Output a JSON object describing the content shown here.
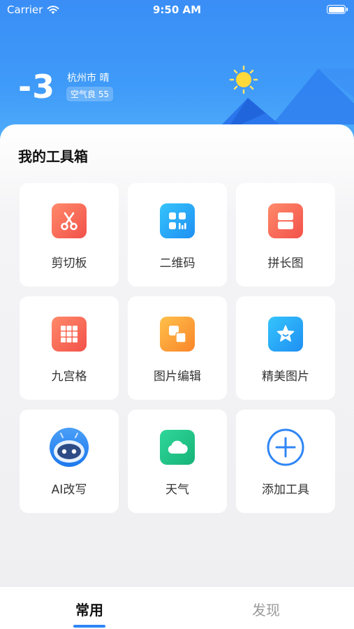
{
  "status_bar": {
    "carrier": "Carrier",
    "time": "9:50 AM"
  },
  "weather": {
    "temperature": "-3",
    "city_condition": "杭州市 晴",
    "air_quality": "空气良 55"
  },
  "toolbox": {
    "title": "我的工具箱",
    "tools": [
      {
        "label": "剪切板",
        "icon": "scissors-icon"
      },
      {
        "label": "二维码",
        "icon": "qrcode-icon"
      },
      {
        "label": "拼长图",
        "icon": "long-image-icon"
      },
      {
        "label": "九宫格",
        "icon": "grid-icon"
      },
      {
        "label": "图片编辑",
        "icon": "image-edit-icon"
      },
      {
        "label": "精美图片",
        "icon": "star-image-icon"
      },
      {
        "label": "AI改写",
        "icon": "robot-icon"
      },
      {
        "label": "天气",
        "icon": "cloud-icon"
      },
      {
        "label": "添加工具",
        "icon": "add-icon"
      }
    ]
  },
  "tabs": [
    {
      "label": "常用",
      "active": true
    },
    {
      "label": "发现",
      "active": false
    }
  ],
  "colors": {
    "accent": "#2f86f6",
    "header_top": "#3a8ef6",
    "header_bottom": "#55b3fb"
  }
}
